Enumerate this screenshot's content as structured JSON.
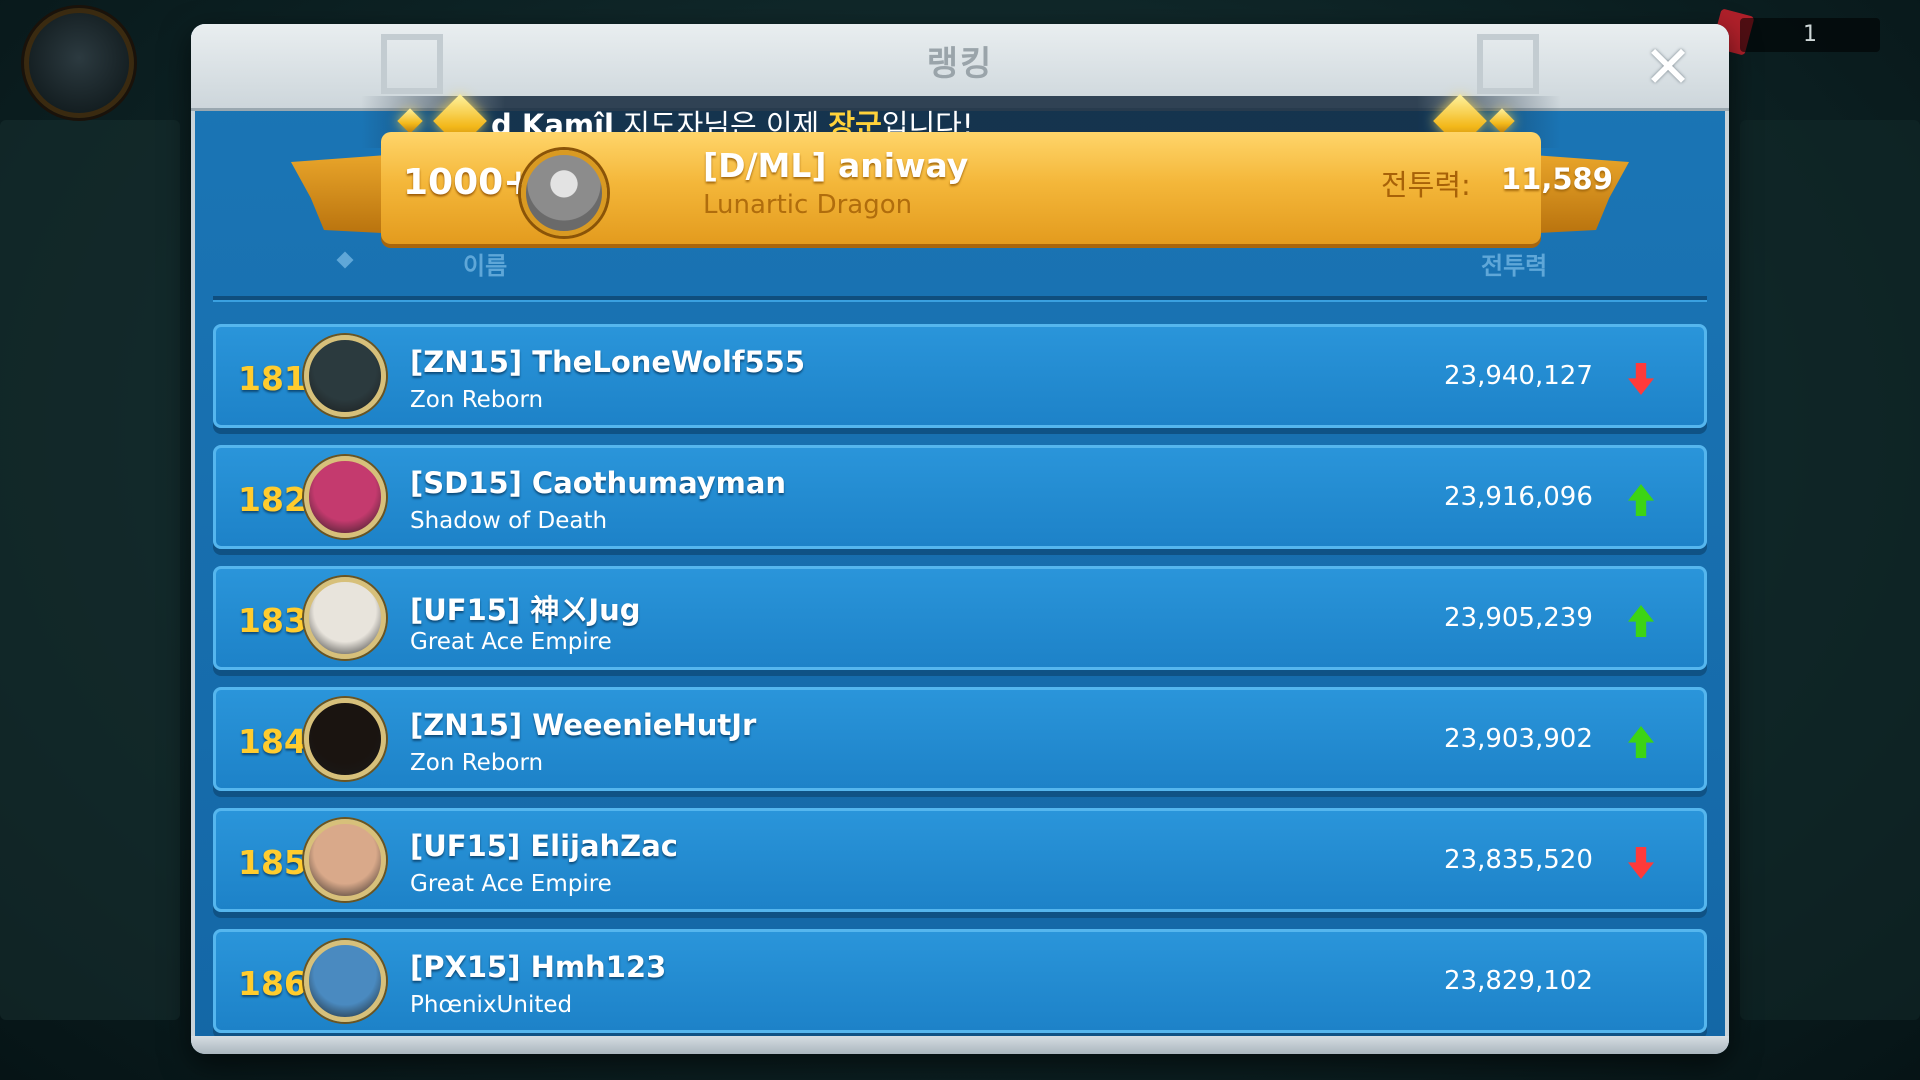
{
  "header": {
    "title": "랭킹",
    "close_label": "✕"
  },
  "announcement": {
    "name": "d Kamîl",
    "middle": " 지도자님은 이제 ",
    "highlight": "장군",
    "end": "입니다!"
  },
  "my_rank": {
    "rank": "1000+",
    "name": "[D/ML] aniway",
    "guild": "Lunartic Dragon",
    "power_label": "전투력:",
    "power_value": "11,589"
  },
  "columns": {
    "name": "이름",
    "power": "전투력"
  },
  "rankings": [
    {
      "rank": "181",
      "name": "[ZN15] TheLoneWolf555",
      "guild": "Zon Reborn",
      "power": "23,940,127",
      "trend": "down",
      "avatar_color": "#2b3a3e"
    },
    {
      "rank": "182",
      "name": "[SD15] Caothumayman",
      "guild": "Shadow of Death",
      "power": "23,916,096",
      "trend": "up",
      "avatar_color": "#c43a6e"
    },
    {
      "rank": "183",
      "name": "[UF15] 神ㄨJug",
      "guild": "Great Ace Empire",
      "power": "23,905,239",
      "trend": "up",
      "avatar_color": "#e8e4dc"
    },
    {
      "rank": "184",
      "name": "[ZN15] WeeenieHutJr",
      "guild": "Zon Reborn",
      "power": "23,903,902",
      "trend": "up",
      "avatar_color": "#1a1410"
    },
    {
      "rank": "185",
      "name": "[UF15] ElijahZac",
      "guild": "Great Ace Empire",
      "power": "23,835,520",
      "trend": "down",
      "avatar_color": "#d9a98a"
    },
    {
      "rank": "186",
      "name": "[PX15] Hmh123",
      "guild": "PhœnixUnited",
      "power": "23,829,102",
      "trend": "none",
      "avatar_color": "#4a8ac0"
    }
  ],
  "hud": {
    "counter": "1"
  }
}
